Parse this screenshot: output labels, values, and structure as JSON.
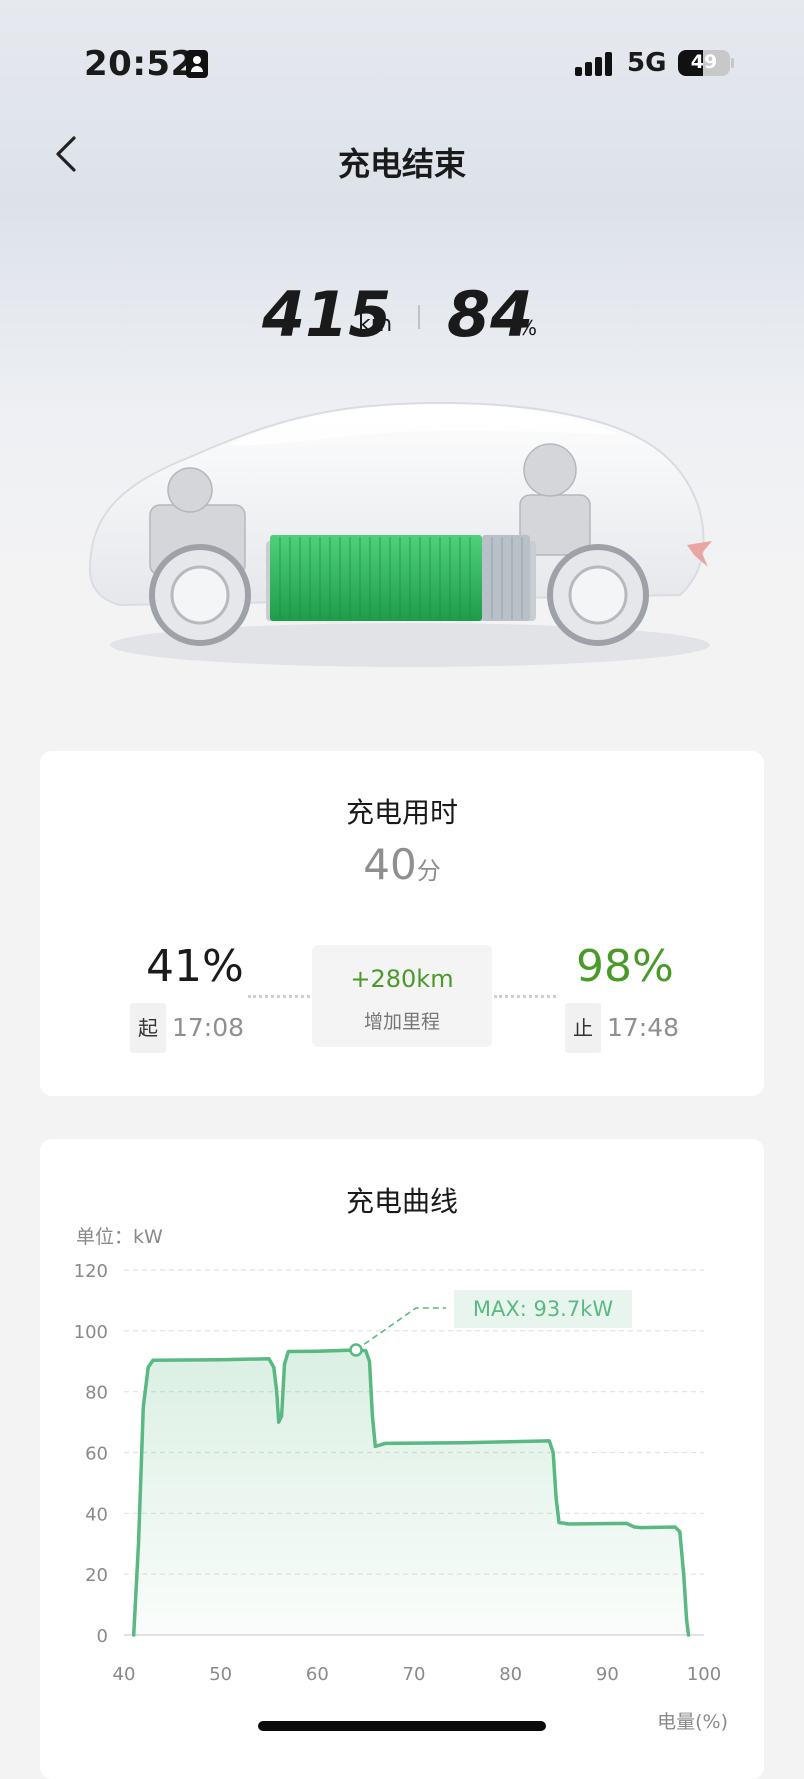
{
  "status_bar": {
    "time": "20:52",
    "network": "5G",
    "battery": "49",
    "battery_level": 0.49
  },
  "header": {
    "title": "充电结束"
  },
  "summary": {
    "range_value": "415",
    "range_unit": "km",
    "soc_value": "84",
    "soc_unit": "%"
  },
  "duration_card": {
    "title": "充电用时",
    "duration_value": "40",
    "duration_unit": "分",
    "start_percent": "41%",
    "start_label": "起",
    "start_time": "17:08",
    "end_percent": "98%",
    "end_label": "止",
    "end_time": "17:48",
    "added_range": "+280km",
    "added_range_label": "增加里程"
  },
  "curve_card": {
    "title": "充电曲线"
  },
  "colors": {
    "accent_green": "#4a9a2a",
    "curve_green": "#5ab882",
    "battery_green": "#2fb55e"
  },
  "chart_data": {
    "type": "area",
    "unit_label": "单位：kW",
    "xlabel": "电量(%)",
    "xlim": [
      40,
      100
    ],
    "ylim": [
      0,
      120
    ],
    "x_ticks": [
      40,
      50,
      60,
      70,
      80,
      90,
      100
    ],
    "y_ticks": [
      0,
      20,
      40,
      60,
      80,
      100,
      120
    ],
    "grid": true,
    "annotation": {
      "text": "MAX: 93.7kW",
      "x": 64.0,
      "y": 93.7
    },
    "x": [
      41,
      41.5,
      42,
      42.5,
      43,
      50,
      55,
      55.5,
      55.8,
      56,
      56.3,
      56.6,
      57,
      60,
      64,
      65,
      65.4,
      65.7,
      66,
      67,
      75,
      84,
      84.4,
      84.7,
      85,
      86,
      92,
      92.8,
      93.5,
      97,
      97.5,
      97.9,
      98.2,
      98.4
    ],
    "series": [
      {
        "values": [
          0,
          30,
          75,
          88,
          90.3,
          90.5,
          90.8,
          88,
          80,
          70,
          72,
          89,
          93.2,
          93.3,
          93.7,
          93.5,
          90,
          72,
          62,
          63,
          63.2,
          63.8,
          60,
          45,
          37,
          36.5,
          36.7,
          35.5,
          35.3,
          35.5,
          34,
          20,
          5,
          0
        ]
      }
    ]
  }
}
